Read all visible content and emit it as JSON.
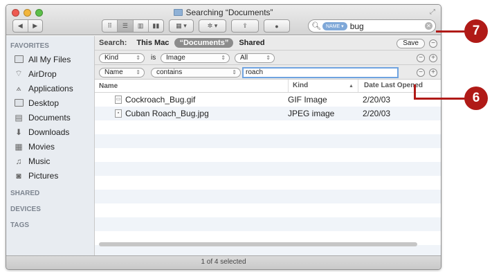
{
  "window": {
    "title": "Searching “Documents”",
    "toolbar": {
      "nav_back": "◀",
      "nav_forward": "▶",
      "view_icons": [
        "⠿",
        "☰",
        "▥",
        "▮▮"
      ],
      "arrange_label": "▦ ▾",
      "action_label": "✲ ▾",
      "share_label": "⇪",
      "tag_label": "●"
    },
    "search": {
      "token": "NAME ▾",
      "query": "bug",
      "clear_label": "✕"
    }
  },
  "sidebar": {
    "favorites_header": "FAVORITES",
    "items": [
      {
        "label": "All My Files",
        "icon": "all-files-icon"
      },
      {
        "label": "AirDrop",
        "icon": "airdrop-icon"
      },
      {
        "label": "Applications",
        "icon": "applications-icon"
      },
      {
        "label": "Desktop",
        "icon": "desktop-icon"
      },
      {
        "label": "Documents",
        "icon": "documents-icon"
      },
      {
        "label": "Downloads",
        "icon": "downloads-icon"
      },
      {
        "label": "Movies",
        "icon": "movies-icon"
      },
      {
        "label": "Music",
        "icon": "music-icon"
      },
      {
        "label": "Pictures",
        "icon": "pictures-icon"
      }
    ],
    "shared_header": "SHARED",
    "devices_header": "DEVICES",
    "tags_header": "TAGS"
  },
  "scope": {
    "label": "Search:",
    "options": [
      "This Mac",
      "“Documents”",
      "Shared"
    ],
    "selected": "“Documents”",
    "save_label": "Save"
  },
  "rules": [
    {
      "attribute": "Kind",
      "operator": "is",
      "value": "Image",
      "value2": "All"
    },
    {
      "attribute": "Name",
      "operator": "contains",
      "value": "roach"
    }
  ],
  "columns": {
    "name": "Name",
    "kind": "Kind",
    "date": "Date Last Opened"
  },
  "files": [
    {
      "name": "Cockroach_Bug.gif",
      "kind": "GIF Image",
      "date": "2/20/03"
    },
    {
      "name": "Cuban Roach_Bug.jpg",
      "kind": "JPEG image",
      "date": "2/20/03"
    }
  ],
  "status": "1 of 4 selected",
  "callouts": {
    "seven": "7",
    "six": "6",
    "color": "#b01a17"
  }
}
